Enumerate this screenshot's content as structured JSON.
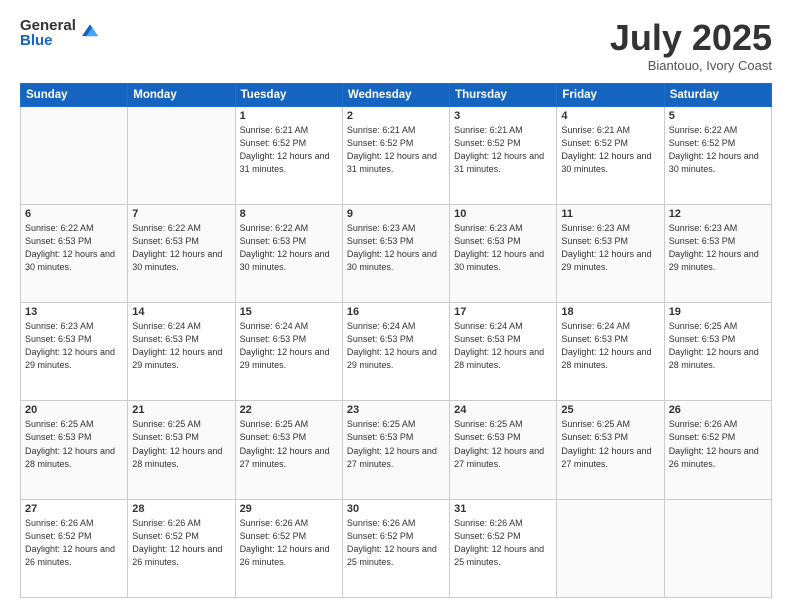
{
  "logo": {
    "general": "General",
    "blue": "Blue"
  },
  "header": {
    "month": "July 2025",
    "location": "Biantouo, Ivory Coast"
  },
  "weekdays": [
    "Sunday",
    "Monday",
    "Tuesday",
    "Wednesday",
    "Thursday",
    "Friday",
    "Saturday"
  ],
  "weeks": [
    [
      {
        "day": "",
        "info": ""
      },
      {
        "day": "",
        "info": ""
      },
      {
        "day": "1",
        "info": "Sunrise: 6:21 AM\nSunset: 6:52 PM\nDaylight: 12 hours and 31 minutes."
      },
      {
        "day": "2",
        "info": "Sunrise: 6:21 AM\nSunset: 6:52 PM\nDaylight: 12 hours and 31 minutes."
      },
      {
        "day": "3",
        "info": "Sunrise: 6:21 AM\nSunset: 6:52 PM\nDaylight: 12 hours and 31 minutes."
      },
      {
        "day": "4",
        "info": "Sunrise: 6:21 AM\nSunset: 6:52 PM\nDaylight: 12 hours and 30 minutes."
      },
      {
        "day": "5",
        "info": "Sunrise: 6:22 AM\nSunset: 6:52 PM\nDaylight: 12 hours and 30 minutes."
      }
    ],
    [
      {
        "day": "6",
        "info": "Sunrise: 6:22 AM\nSunset: 6:53 PM\nDaylight: 12 hours and 30 minutes."
      },
      {
        "day": "7",
        "info": "Sunrise: 6:22 AM\nSunset: 6:53 PM\nDaylight: 12 hours and 30 minutes."
      },
      {
        "day": "8",
        "info": "Sunrise: 6:22 AM\nSunset: 6:53 PM\nDaylight: 12 hours and 30 minutes."
      },
      {
        "day": "9",
        "info": "Sunrise: 6:23 AM\nSunset: 6:53 PM\nDaylight: 12 hours and 30 minutes."
      },
      {
        "day": "10",
        "info": "Sunrise: 6:23 AM\nSunset: 6:53 PM\nDaylight: 12 hours and 30 minutes."
      },
      {
        "day": "11",
        "info": "Sunrise: 6:23 AM\nSunset: 6:53 PM\nDaylight: 12 hours and 29 minutes."
      },
      {
        "day": "12",
        "info": "Sunrise: 6:23 AM\nSunset: 6:53 PM\nDaylight: 12 hours and 29 minutes."
      }
    ],
    [
      {
        "day": "13",
        "info": "Sunrise: 6:23 AM\nSunset: 6:53 PM\nDaylight: 12 hours and 29 minutes."
      },
      {
        "day": "14",
        "info": "Sunrise: 6:24 AM\nSunset: 6:53 PM\nDaylight: 12 hours and 29 minutes."
      },
      {
        "day": "15",
        "info": "Sunrise: 6:24 AM\nSunset: 6:53 PM\nDaylight: 12 hours and 29 minutes."
      },
      {
        "day": "16",
        "info": "Sunrise: 6:24 AM\nSunset: 6:53 PM\nDaylight: 12 hours and 29 minutes."
      },
      {
        "day": "17",
        "info": "Sunrise: 6:24 AM\nSunset: 6:53 PM\nDaylight: 12 hours and 28 minutes."
      },
      {
        "day": "18",
        "info": "Sunrise: 6:24 AM\nSunset: 6:53 PM\nDaylight: 12 hours and 28 minutes."
      },
      {
        "day": "19",
        "info": "Sunrise: 6:25 AM\nSunset: 6:53 PM\nDaylight: 12 hours and 28 minutes."
      }
    ],
    [
      {
        "day": "20",
        "info": "Sunrise: 6:25 AM\nSunset: 6:53 PM\nDaylight: 12 hours and 28 minutes."
      },
      {
        "day": "21",
        "info": "Sunrise: 6:25 AM\nSunset: 6:53 PM\nDaylight: 12 hours and 28 minutes."
      },
      {
        "day": "22",
        "info": "Sunrise: 6:25 AM\nSunset: 6:53 PM\nDaylight: 12 hours and 27 minutes."
      },
      {
        "day": "23",
        "info": "Sunrise: 6:25 AM\nSunset: 6:53 PM\nDaylight: 12 hours and 27 minutes."
      },
      {
        "day": "24",
        "info": "Sunrise: 6:25 AM\nSunset: 6:53 PM\nDaylight: 12 hours and 27 minutes."
      },
      {
        "day": "25",
        "info": "Sunrise: 6:25 AM\nSunset: 6:53 PM\nDaylight: 12 hours and 27 minutes."
      },
      {
        "day": "26",
        "info": "Sunrise: 6:26 AM\nSunset: 6:52 PM\nDaylight: 12 hours and 26 minutes."
      }
    ],
    [
      {
        "day": "27",
        "info": "Sunrise: 6:26 AM\nSunset: 6:52 PM\nDaylight: 12 hours and 26 minutes."
      },
      {
        "day": "28",
        "info": "Sunrise: 6:26 AM\nSunset: 6:52 PM\nDaylight: 12 hours and 26 minutes."
      },
      {
        "day": "29",
        "info": "Sunrise: 6:26 AM\nSunset: 6:52 PM\nDaylight: 12 hours and 26 minutes."
      },
      {
        "day": "30",
        "info": "Sunrise: 6:26 AM\nSunset: 6:52 PM\nDaylight: 12 hours and 25 minutes."
      },
      {
        "day": "31",
        "info": "Sunrise: 6:26 AM\nSunset: 6:52 PM\nDaylight: 12 hours and 25 minutes."
      },
      {
        "day": "",
        "info": ""
      },
      {
        "day": "",
        "info": ""
      }
    ]
  ]
}
